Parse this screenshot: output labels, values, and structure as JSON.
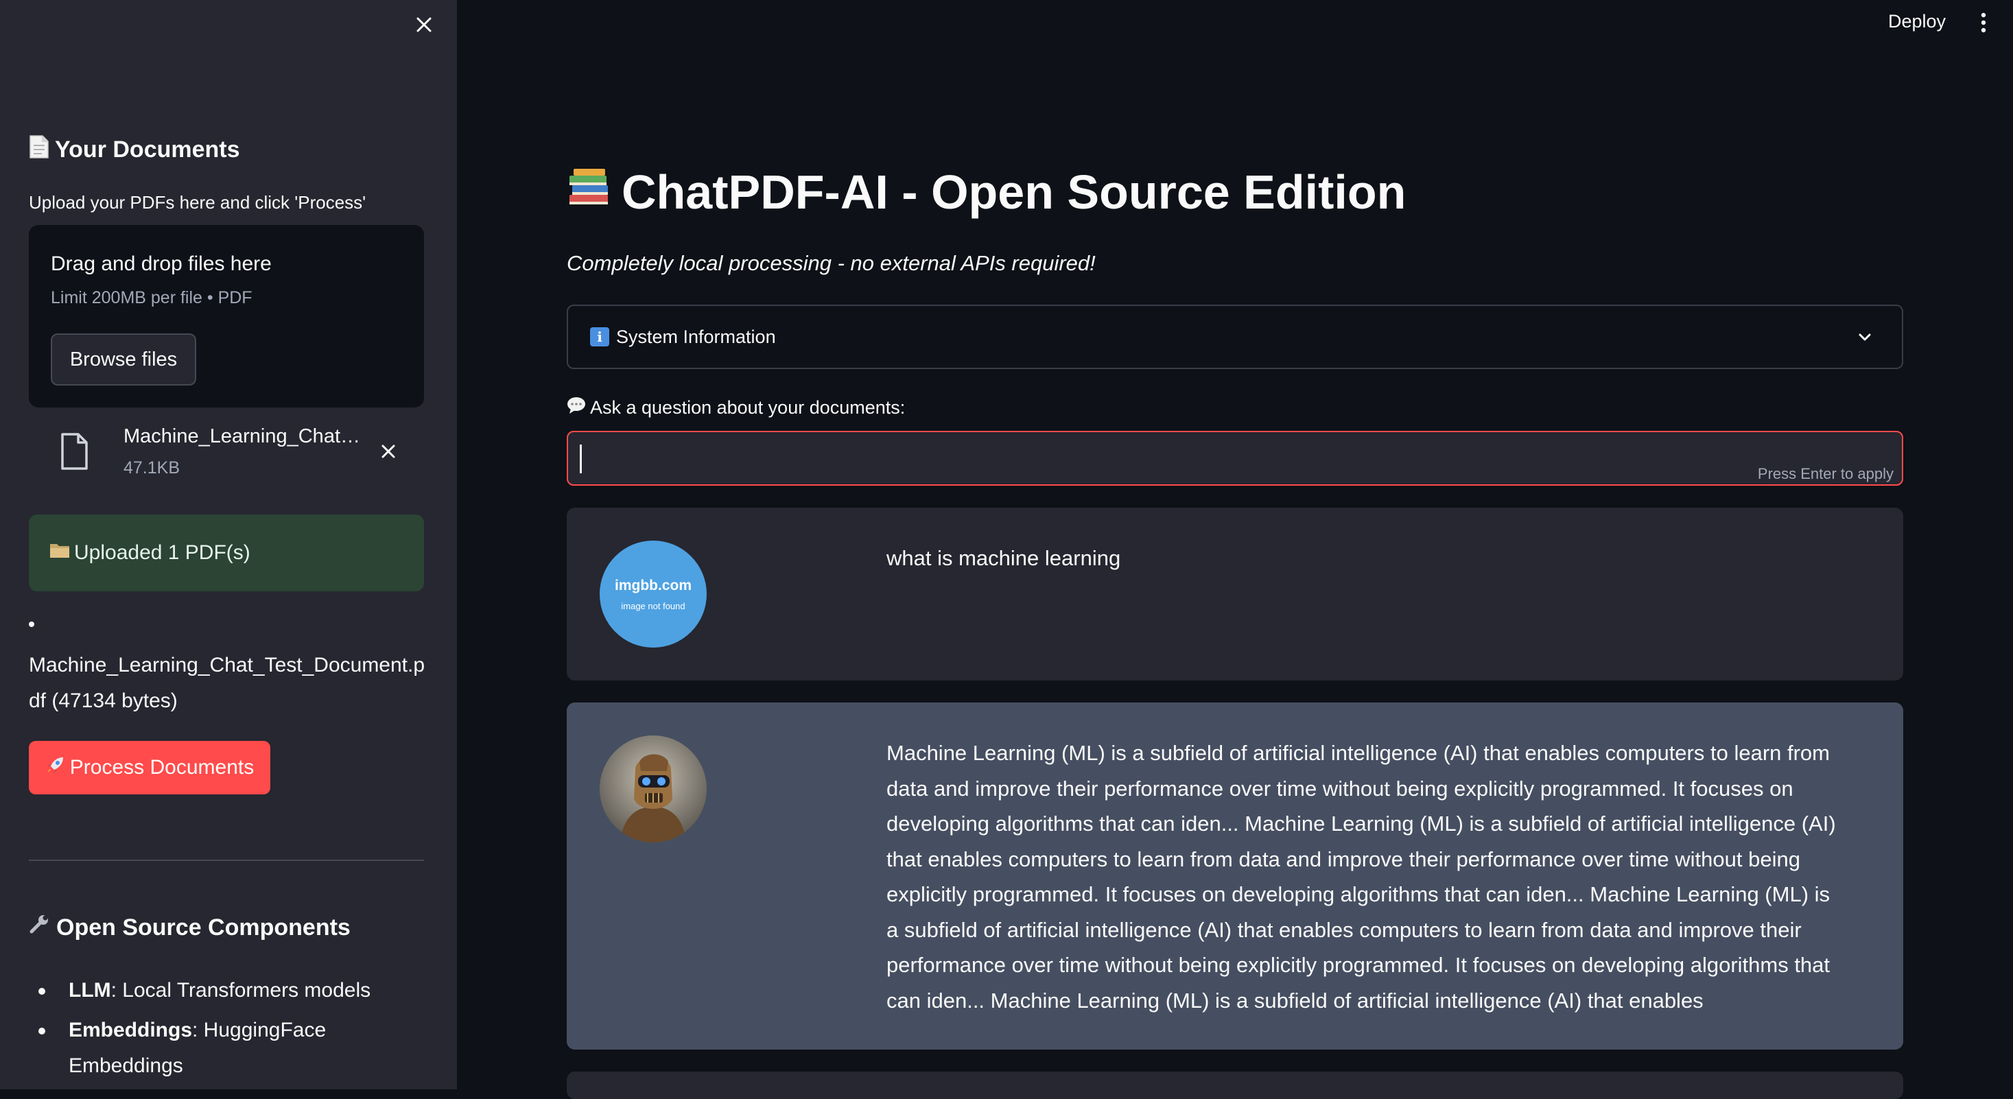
{
  "sidebar": {
    "documents_heading": "Your Documents",
    "documents_heading_icon": "page-icon",
    "upload_caption": "Upload your PDFs here and click 'Process'",
    "dropzone": {
      "title": "Drag and drop files here",
      "limit": "Limit 200MB per file • PDF",
      "browse_label": "Browse files"
    },
    "uploaded_file": {
      "name": "Machine_Learning_Chat_Test_Document.pdf",
      "size": "47.1KB"
    },
    "success_message": "Uploaded 1 PDF(s)",
    "file_list": [
      "Machine_Learning_Chat_Test_Document.pdf (47134 bytes)"
    ],
    "process_button": "Process Documents",
    "components_heading": "Open Source Components",
    "components": [
      {
        "label": "LLM",
        "value": ": Local Transformers models"
      },
      {
        "label": "Embeddings",
        "value": ": HuggingFace Embeddings"
      }
    ]
  },
  "header": {
    "deploy_label": "Deploy"
  },
  "main": {
    "title": "ChatPDF-AI - Open Source Edition",
    "subtitle": "Completely local processing - no external APIs required!",
    "system_info_label": "System Information",
    "question_label": "Ask a question about your documents:",
    "question_value": "",
    "press_enter_hint": "Press Enter to apply",
    "messages": [
      {
        "role": "user",
        "avatar_text_1": "imgbb.com",
        "avatar_text_2": "image not found",
        "text": "what is machine learning"
      },
      {
        "role": "bot",
        "text": "Machine Learning (ML) is a subfield of artificial intelligence (AI) that enables computers to learn from data and improve their performance over time without being explicitly programmed. It focuses on developing algorithms that can iden... Machine Learning (ML) is a subfield of artificial intelligence (AI) that enables computers to learn from data and improve their performance over time without being explicitly programmed. It focuses on developing algorithms that can iden... Machine Learning (ML) is a subfield of artificial intelligence (AI) that enables computers to learn from data and improve their performance over time without being explicitly programmed. It focuses on developing algorithms that can iden... Machine Learning (ML) is a subfield of artificial intelligence (AI) that enables"
      }
    ]
  },
  "colors": {
    "app_background": "#0e1117",
    "sidebar_background": "#262730",
    "primary": "#ff4b4b",
    "success_background": "#2b4434",
    "bot_message_background": "#464f61"
  }
}
